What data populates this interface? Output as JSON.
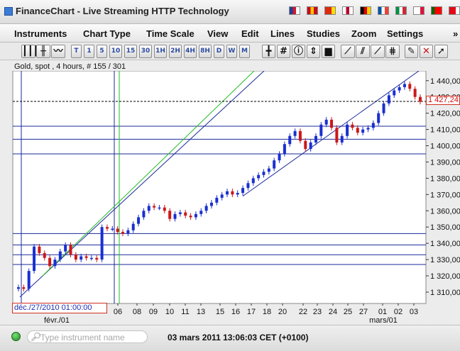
{
  "window": {
    "title": "FinanceChart - Live Streaming HTTP Technology",
    "flags": [
      {
        "name": "uk-flag",
        "colors": [
          "#1f3f9a",
          "#cf1b2b",
          "#ffffff"
        ]
      },
      {
        "name": "spain-flag",
        "colors": [
          "#c60b1e",
          "#ffc400",
          "#c60b1e"
        ]
      },
      {
        "name": "china-flag",
        "colors": [
          "#de2910",
          "#de2910",
          "#ffde00"
        ]
      },
      {
        "name": "japan-flag",
        "colors": [
          "#ffffff",
          "#bc002d",
          "#ffffff"
        ]
      },
      {
        "name": "germany-flag",
        "colors": [
          "#000000",
          "#dd0000",
          "#ffce00"
        ]
      },
      {
        "name": "france-flag",
        "colors": [
          "#0055a4",
          "#ffffff",
          "#ef4135"
        ]
      },
      {
        "name": "italy-flag",
        "colors": [
          "#009246",
          "#ffffff",
          "#ce2b37"
        ]
      },
      {
        "name": "poland-flag",
        "colors": [
          "#ffffff",
          "#ffffff",
          "#dc143c"
        ]
      },
      {
        "name": "portugal-flag",
        "colors": [
          "#006600",
          "#ff0000",
          "#ff0000"
        ]
      },
      {
        "name": "turkey-flag",
        "colors": [
          "#e30a17",
          "#e30a17",
          "#ffffff"
        ]
      }
    ]
  },
  "menu": [
    {
      "name": "menu-instruments",
      "label": "Instruments"
    },
    {
      "name": "menu-chart-type",
      "label": "Chart Type"
    },
    {
      "name": "menu-time-scale",
      "label": "Time Scale"
    },
    {
      "name": "menu-view",
      "label": "View"
    },
    {
      "name": "menu-edit",
      "label": "Edit"
    },
    {
      "name": "menu-lines",
      "label": "Lines"
    },
    {
      "name": "menu-studies",
      "label": "Studies"
    },
    {
      "name": "menu-zoom",
      "label": "Zoom"
    },
    {
      "name": "menu-settings",
      "label": "Settings"
    },
    {
      "name": "menu-more",
      "label": "»"
    }
  ],
  "toolbar": {
    "chart_types": [
      {
        "name": "candlestick-chart-button",
        "label": "┃┃┃"
      },
      {
        "name": "bar-chart-button",
        "label": "╫"
      },
      {
        "name": "line-chart-button",
        "label": "〰"
      }
    ],
    "timeframes": [
      "T",
      "1",
      "5",
      "10",
      "15",
      "30",
      "1H",
      "2H",
      "4H",
      "8H",
      "D",
      "W",
      "M"
    ],
    "tools": [
      {
        "name": "crosshair-button",
        "label": "╋"
      },
      {
        "name": "grid-button",
        "label": "#"
      },
      {
        "name": "info-button",
        "label": "ⓘ"
      },
      {
        "name": "zoom-fit-button",
        "label": "⇕"
      },
      {
        "name": "volume-button",
        "label": "▆"
      }
    ],
    "line_tools": [
      {
        "name": "trendline-button",
        "label": "⟋"
      },
      {
        "name": "channel-button",
        "label": "⫽"
      },
      {
        "name": "fan-button",
        "label": "⟋"
      },
      {
        "name": "fib-button",
        "label": "⋕"
      }
    ],
    "edit_tools": [
      {
        "name": "draw-line-button",
        "label": "✎"
      },
      {
        "name": "delete-button",
        "label": "✕"
      },
      {
        "name": "pointer-button",
        "label": "➚"
      }
    ]
  },
  "chart": {
    "header": "Gold, spot , 4 hours, # 155 / 301",
    "current_price": "1 427,24",
    "cursor_date": "déc./27/2010 01:00:00",
    "colors": {
      "candle": "#1a2fd0",
      "candle_down": "#cc1818",
      "grid": "#1a2a9a",
      "green_line": "#22bb22",
      "price_line": "#000000"
    }
  },
  "chart_data": {
    "type": "candlestick",
    "title": "Gold, spot , 4 hours, # 155 / 301",
    "xlabel": "",
    "ylabel": "",
    "ylim": [
      1303,
      1446
    ],
    "y_ticks": [
      "1 440,00",
      "1 430,00",
      "1 420,00",
      "1 410,00",
      "1 400,00",
      "1 390,00",
      "1 380,00",
      "1 370,00",
      "1 360,00",
      "1 350,00",
      "1 340,00",
      "1 330,00",
      "1 320,00",
      "1 310,00"
    ],
    "y_tick_values": [
      1440,
      1430,
      1420,
      1410,
      1400,
      1390,
      1380,
      1370,
      1360,
      1350,
      1340,
      1330,
      1320,
      1310
    ],
    "x_ticks": [
      "06",
      "08",
      "09",
      "10",
      "11",
      "13",
      "15",
      "16",
      "17",
      "18",
      "20",
      "22",
      "23",
      "24",
      "25",
      "27",
      "01",
      "02",
      "03"
    ],
    "x_month_labels": [
      "févr./01",
      "mars/01"
    ],
    "horizontal_levels": [
      1412,
      1404,
      1395,
      1346,
      1339,
      1333,
      1327
    ],
    "last_price": 1427.24,
    "close_series": [
      1313,
      1312,
      1323,
      1338,
      1334,
      1331,
      1326,
      1330,
      1335,
      1339,
      1333,
      1330,
      1332,
      1331,
      1331,
      1330,
      1350,
      1349,
      1349,
      1347,
      1346,
      1348,
      1352,
      1356,
      1360,
      1363,
      1362,
      1362,
      1360,
      1355,
      1358,
      1359,
      1357,
      1356,
      1358,
      1360,
      1363,
      1365,
      1368,
      1370,
      1372,
      1370,
      1371,
      1374,
      1377,
      1380,
      1382,
      1384,
      1386,
      1391,
      1395,
      1401,
      1406,
      1409,
      1403,
      1398,
      1402,
      1406,
      1413,
      1416,
      1411,
      1402,
      1406,
      1413,
      1411,
      1408,
      1410,
      1411,
      1414,
      1420,
      1426,
      1431,
      1434,
      1436,
      1438,
      1435,
      1430,
      1427
    ]
  },
  "status": {
    "search_placeholder": "Type instrument name",
    "time": "03 mars 2011 13:06:03 CET (+0100)"
  }
}
